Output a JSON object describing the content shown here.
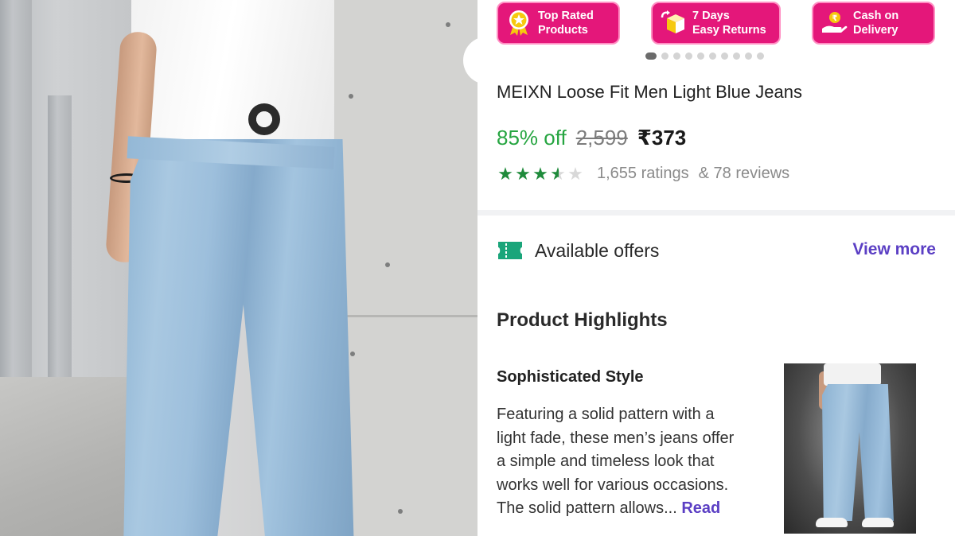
{
  "badges": [
    {
      "icon": "rosette-star-icon",
      "label": "Top Rated\nProducts"
    },
    {
      "icon": "box-return-icon",
      "label": "7 Days\nEasy Returns"
    },
    {
      "icon": "cash-hand-icon",
      "label": "Cash on\nDelivery"
    }
  ],
  "carousel": {
    "total_slides": 10,
    "active_index": 0
  },
  "product": {
    "title": "MEIXN Loose Fit Men Light Blue Jeans",
    "discount": "85% off",
    "mrp": "2,599",
    "price": "₹373",
    "rating_value": 3.5,
    "ratings_text": "1,655 ratings",
    "reviews_text": "& 78 reviews"
  },
  "offers": {
    "label": "Available offers",
    "view_more": "View more"
  },
  "highlights": {
    "title": "Product Highlights",
    "feature_title": "Sophisticated Style",
    "feature_desc": "Featuring a solid pattern with a light fade, these men’s jeans offer a simple and timeless look that works well for various occasions. The solid pattern allows...",
    "read_more": "Read"
  },
  "colors": {
    "badge_bg": "#e4177a",
    "discount": "#26a541",
    "star": "#1f8b3b",
    "link": "#5b3fc4"
  }
}
